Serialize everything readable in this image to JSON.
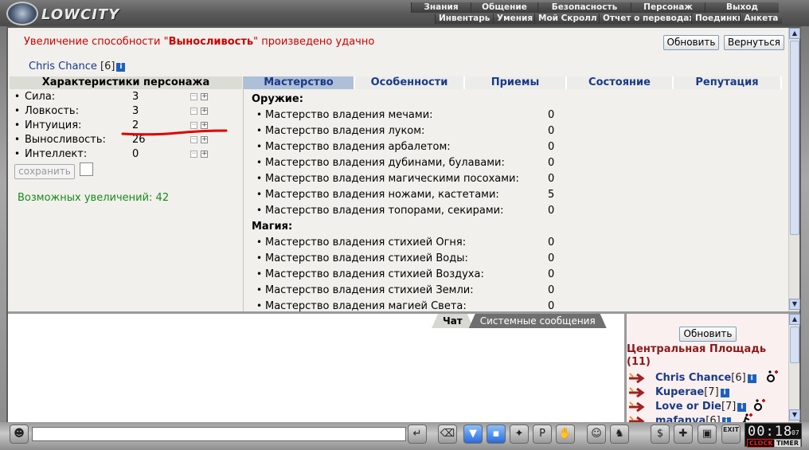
{
  "logo_text": "LOWCITY",
  "menu_top": [
    "Знания",
    "Общение",
    "Безопасность",
    "Персонаж",
    "Выход"
  ],
  "menu_bottom": [
    "Инвентарь",
    "Умения",
    "Мой Скролл",
    "Отчет о переводах",
    "Поединки",
    "Анкета"
  ],
  "message": {
    "prefix": "Увеличение способности \"",
    "stat": "Выносливость",
    "suffix": "\" произведено удачно"
  },
  "buttons": {
    "refresh": "Обновить",
    "back": "Вернуться",
    "save": "сохранить"
  },
  "character": {
    "name": "Chris Chance",
    "level": "[6]",
    "info_icon": "i"
  },
  "stats": {
    "header": "Характеристики персонажа",
    "items": [
      {
        "label": "Сила:",
        "value": "3"
      },
      {
        "label": "Ловкость:",
        "value": "3"
      },
      {
        "label": "Интуиция:",
        "value": "2"
      },
      {
        "label": "Выносливость:",
        "value": "26"
      },
      {
        "label": "Интеллект:",
        "value": "0"
      }
    ],
    "possible_increases": "Возможных увеличений: 42"
  },
  "tabs": [
    "Мастерство",
    "Особенности",
    "Приемы",
    "Состояние",
    "Репутация"
  ],
  "skills": {
    "weapons_header": "Оружие:",
    "weapons": [
      {
        "label": "Мастерство владения мечами:",
        "value": "0"
      },
      {
        "label": "Мастерство владения луком:",
        "value": "0"
      },
      {
        "label": "Мастерство владения арбалетом:",
        "value": "0"
      },
      {
        "label": "Мастерство владения дубинами, булавами:",
        "value": "0"
      },
      {
        "label": "Мастерство владения магическими посохами:",
        "value": "0"
      },
      {
        "label": "Мастерство владения ножами, кастетами:",
        "value": "5"
      },
      {
        "label": "Мастерство владения топорами, секирами:",
        "value": "0"
      }
    ],
    "magic_header": "Магия:",
    "magic": [
      {
        "label": "Мастерство владения стихией Огня:",
        "value": "0"
      },
      {
        "label": "Мастерство владения стихией Воды:",
        "value": "0"
      },
      {
        "label": "Мастерство владения стихией Воздуха:",
        "value": "0"
      },
      {
        "label": "Мастерство владения стихией Земли:",
        "value": "0"
      },
      {
        "label": "Мастерство владения магией Света:",
        "value": "0"
      }
    ]
  },
  "chat_tabs": [
    "Чат",
    "Системные сообщения"
  ],
  "online": {
    "refresh": "Обновить",
    "location": "Центральная Площадь (11)",
    "users": [
      {
        "name": "Chris Chance",
        "level": "[6]"
      },
      {
        "name": "Kuperae",
        "level": "[7]"
      },
      {
        "name": "Love or Die",
        "level": "[7]"
      },
      {
        "name": "mafanya",
        "level": "[6]"
      }
    ]
  },
  "toolbar": {
    "chat_value": "",
    "exit_label": "EXIT"
  },
  "clock": {
    "time": "00:18",
    "seconds": "07",
    "clock_label": "CLOCK",
    "timer_label": "TIMER"
  }
}
